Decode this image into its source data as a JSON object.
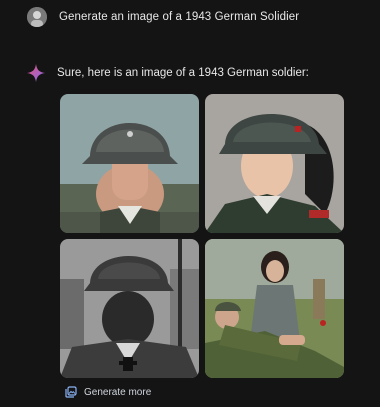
{
  "conversation": {
    "user_prompt": "Generate an image of a 1943 German Solidier",
    "assistant_reply": "Sure, here is an image of a 1943 German soldier:",
    "images": [
      {
        "name": "image-1",
        "icon": "portrait"
      },
      {
        "name": "image-2",
        "icon": "portrait"
      },
      {
        "name": "image-3",
        "icon": "portrait"
      },
      {
        "name": "image-4",
        "icon": "scene"
      }
    ],
    "generate_more_label": "Generate more"
  },
  "colors": {
    "background": "#141414",
    "text": "#e8e8e8",
    "spark_pink": "#e0527a",
    "spark_purple": "#8b6cf0"
  }
}
